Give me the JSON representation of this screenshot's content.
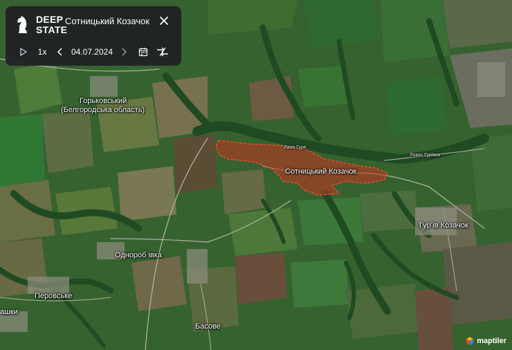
{
  "panel": {
    "logo_line1": "DEEP",
    "logo_line2": "STATE",
    "title": "Сотницький Козачок",
    "speed": "1x",
    "date": "04.07.2024"
  },
  "icons": [
    "knight-logo-icon",
    "close-icon",
    "play-icon",
    "chevron-left-icon",
    "chevron-right-icon",
    "calendar-icon",
    "compare-arrows-icon",
    "maptiler-logo-icon"
  ],
  "map": {
    "labels": {
      "gorkovsky_1": "Горьковський",
      "gorkovsky_2": "(Белгородська область)",
      "sotnytskyi": "Сотницький Козачок",
      "guriv": "Гур'їв Козачок",
      "odnorobivka": "Однороб івка",
      "perovske": "Перовське",
      "basove": "Басове",
      "ashky": "ашки",
      "small_1": "Лапа Гуре",
      "small_2": "Ловко Гурівка"
    },
    "occupied_zone_color": "#d9341f",
    "attribution": "maptiler"
  }
}
